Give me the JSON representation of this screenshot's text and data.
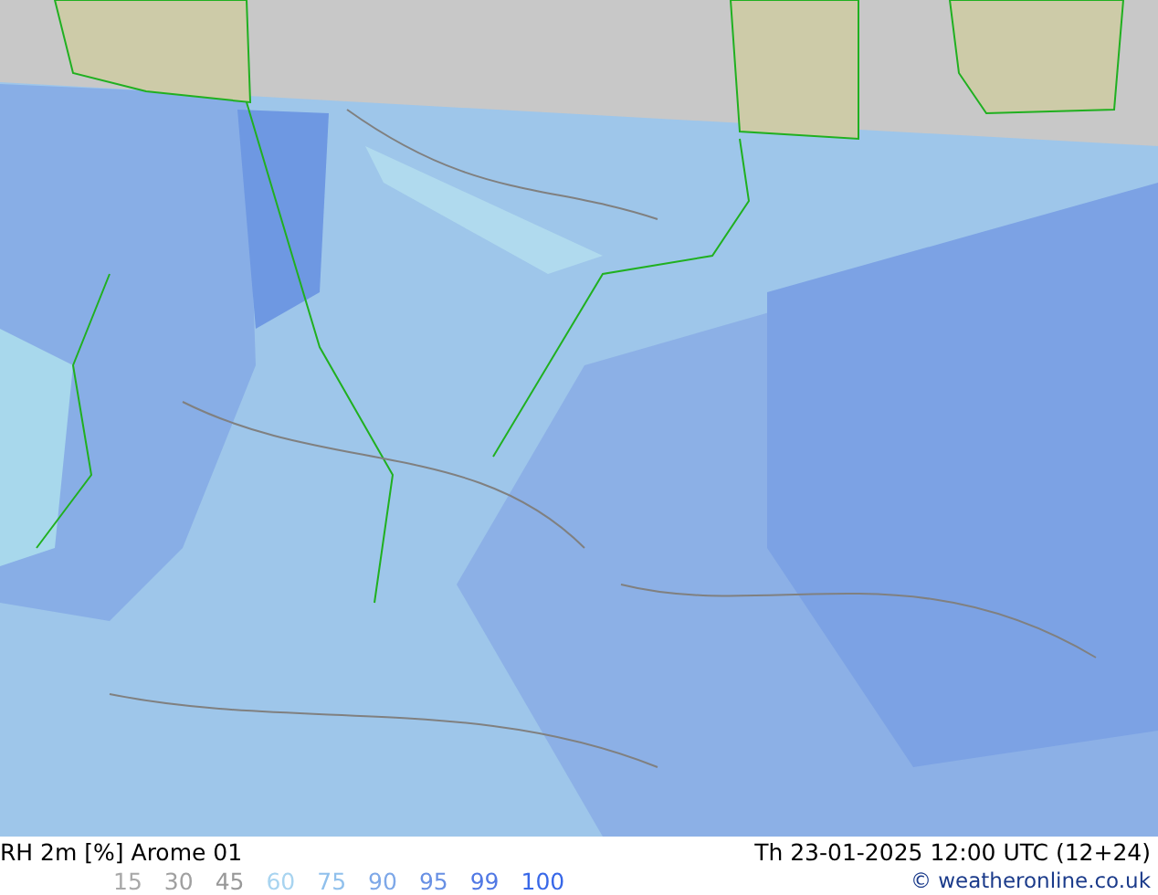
{
  "map": {
    "title": "RH 2m [%] Arome 01",
    "valid_time": "Th 23-01-2025 12:00 UTC (12+24)"
  },
  "legend": [
    {
      "label": "15",
      "color": "#a8a8a8"
    },
    {
      "label": "30",
      "color": "#a0a0a0"
    },
    {
      "label": "45",
      "color": "#989898"
    },
    {
      "label": "60",
      "color": "#a8d4f0"
    },
    {
      "label": "75",
      "color": "#90c0ec"
    },
    {
      "label": "90",
      "color": "#7ea8e8"
    },
    {
      "label": "95",
      "color": "#6890e4"
    },
    {
      "label": "99",
      "color": "#5078e4"
    },
    {
      "label": "100",
      "color": "#3868e8"
    }
  ],
  "credit": "© weatheronline.co.uk"
}
